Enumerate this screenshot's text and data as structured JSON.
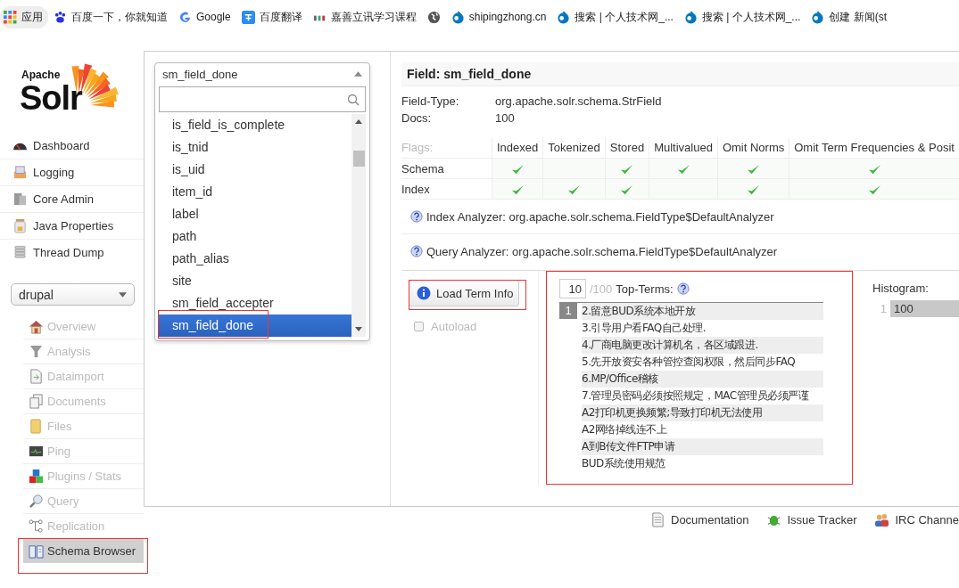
{
  "bookmarks": [
    {
      "label": "应用",
      "kind": "apps"
    },
    {
      "label": "百度一下，你就知道",
      "kind": "paw"
    },
    {
      "label": "Google",
      "kind": "g"
    },
    {
      "label": "百度翻译",
      "kind": "translate"
    },
    {
      "label": "嘉善立讯学习课程",
      "kind": "small"
    },
    {
      "kind": "globe"
    },
    {
      "label": "shipingzhong.cn",
      "kind": "drop"
    },
    {
      "label": "搜索 | 个人技术网_...",
      "kind": "drop"
    },
    {
      "label": "搜索 | 个人技术网_...",
      "kind": "drop"
    },
    {
      "label": "创建 新闻(st",
      "kind": "drop"
    }
  ],
  "logo": {
    "small": "Apache",
    "big": "Solr"
  },
  "nav": [
    {
      "label": "Dashboard",
      "kind": "gauge"
    },
    {
      "label": "Logging",
      "kind": "log"
    },
    {
      "label": "Core Admin",
      "kind": "server"
    },
    {
      "label": "Java Properties",
      "kind": "jar"
    },
    {
      "label": "Thread Dump",
      "kind": "stack"
    }
  ],
  "core_select": {
    "value": "drupal"
  },
  "core_menu": [
    {
      "label": "Overview",
      "kind": "house",
      "selected": false
    },
    {
      "label": "Analysis",
      "kind": "funnel",
      "selected": false
    },
    {
      "label": "Dataimport",
      "kind": "doc",
      "selected": false
    },
    {
      "label": "Documents",
      "kind": "docs",
      "selected": false
    },
    {
      "label": "Files",
      "kind": "folder",
      "selected": false
    },
    {
      "label": "Ping",
      "kind": "monitor",
      "selected": false
    },
    {
      "label": "Plugins / Stats",
      "kind": "blocks",
      "selected": false
    },
    {
      "label": "Query",
      "kind": "search",
      "selected": false
    },
    {
      "label": "Replication",
      "kind": "nodes",
      "selected": false
    },
    {
      "label": "Schema Browser",
      "kind": "book",
      "selected": true
    }
  ],
  "field_dropdown": {
    "value": "sm_field_done",
    "items": [
      {
        "label": "is_field_is_complete",
        "selected": false
      },
      {
        "label": "is_tnid",
        "selected": false
      },
      {
        "label": "is_uid",
        "selected": false
      },
      {
        "label": "item_id",
        "selected": false
      },
      {
        "label": "label",
        "selected": false
      },
      {
        "label": "path",
        "selected": false
      },
      {
        "label": "path_alias",
        "selected": false
      },
      {
        "label": "site",
        "selected": false
      },
      {
        "label": "sm_field_accepter",
        "selected": false
      },
      {
        "label": "sm_field_done",
        "selected": true
      }
    ]
  },
  "field": {
    "title": "Field: sm_field_done",
    "props": [
      {
        "label": "Field-Type:",
        "value": "org.apache.solr.schema.StrField"
      },
      {
        "label": "Docs:",
        "value": "100"
      }
    ],
    "flags": {
      "label": "Flags:",
      "columns": [
        "Indexed",
        "Tokenized",
        "Stored",
        "Multivalued",
        "Omit Norms",
        "Omit Term Frequencies & Posit"
      ],
      "rows": [
        {
          "label": "Schema",
          "values": [
            true,
            false,
            true,
            true,
            true,
            true
          ]
        },
        {
          "label": "Index",
          "values": [
            true,
            true,
            true,
            false,
            true,
            true
          ]
        }
      ]
    },
    "analyzers": [
      {
        "label": "Index Analyzer:",
        "value": "org.apache.solr.schema.FieldType$DefaultAnalyzer"
      },
      {
        "label": "Query Analyzer:",
        "value": "org.apache.solr.schema.FieldType$DefaultAnalyzer"
      }
    ]
  },
  "terms": {
    "button": "Load Term Info",
    "autoload": {
      "label": "Autoload",
      "checked": false
    },
    "count": "10",
    "total": "/100",
    "label": "Top-Terms:",
    "frequency": "1",
    "items": [
      "2.留意BUD系统本地开放",
      "3.引导用户看FAQ自己处理.",
      "4.厂商电脑更改计算机名，各区域跟进.",
      "5.先开放资安各种管控查阅权限，然后同步FAQ",
      "6.MP/Office稽核",
      "7.管理员密码必须按照规定，MAC管理员必须严谨",
      "A2打印机更换频繁;导致打印机无法使用",
      "A2网络掉线连不上",
      "A到B传文件FTP申请",
      "BUD系统使用规范"
    ]
  },
  "histogram": {
    "label": "Histogram:",
    "rows": [
      {
        "key": "1",
        "value": "100"
      }
    ]
  },
  "footer": [
    {
      "label": "Documentation",
      "kind": "doc"
    },
    {
      "label": "Issue Tracker",
      "kind": "bug"
    },
    {
      "label": "IRC Channe",
      "kind": "people"
    }
  ]
}
